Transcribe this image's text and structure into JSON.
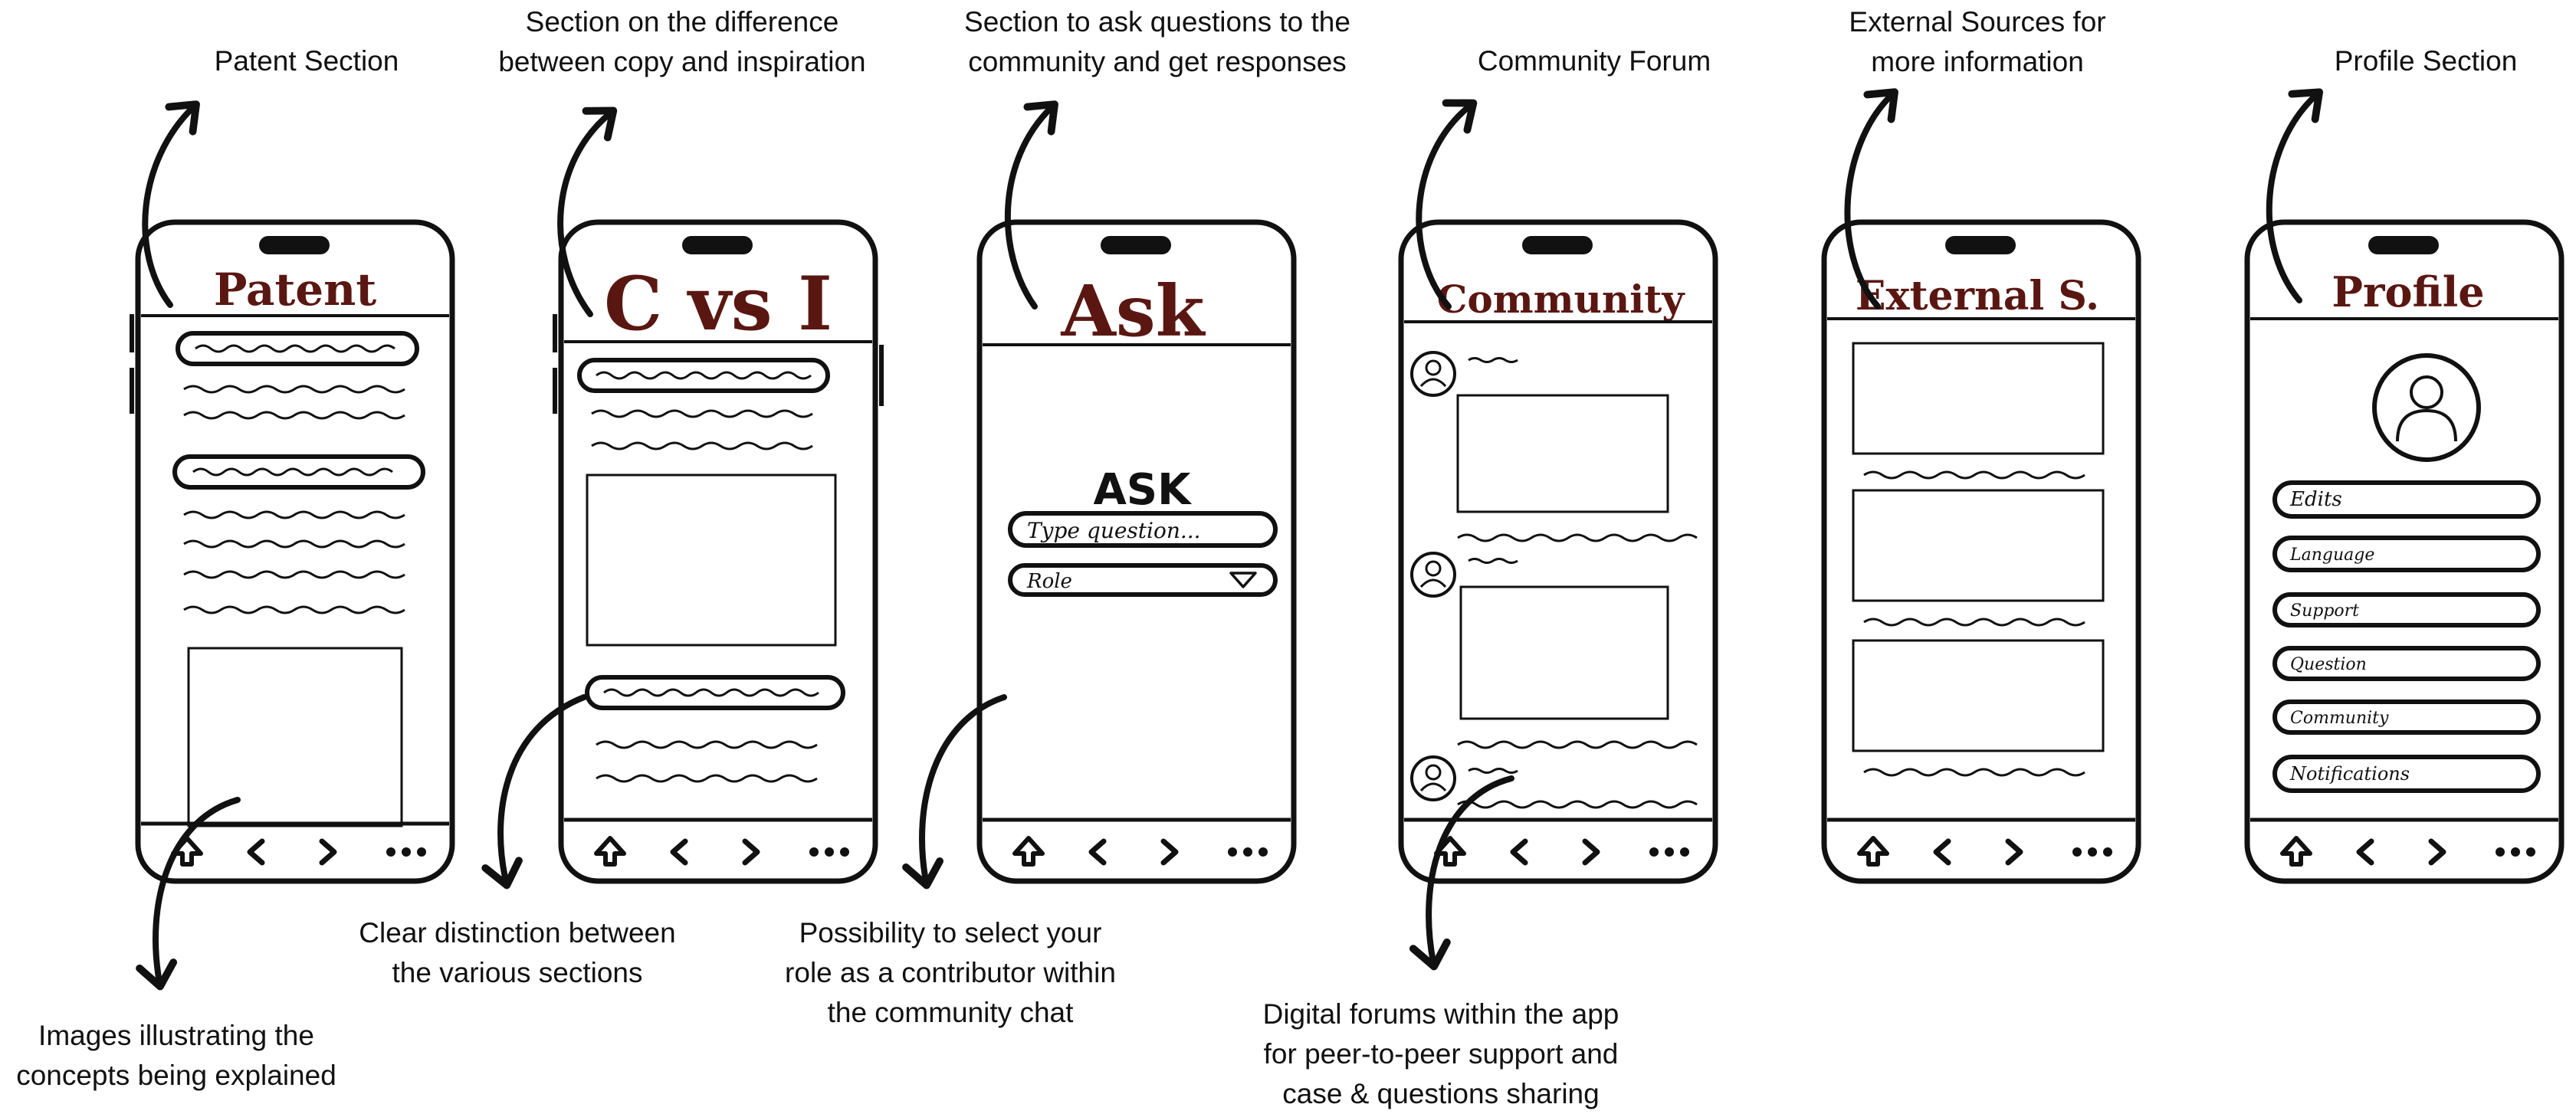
{
  "colors": {
    "ink": "#111111",
    "title_ink": "#5a1712",
    "paper": "#ffffff"
  },
  "top_annotations": [
    {
      "lines": [
        "Patent Section"
      ]
    },
    {
      "lines": [
        "Section on the difference",
        "between copy and inspiration"
      ]
    },
    {
      "lines": [
        "Section to ask questions to the",
        "community and get responses"
      ]
    },
    {
      "lines": [
        "Community Forum"
      ]
    },
    {
      "lines": [
        "External Sources for",
        "more information"
      ]
    },
    {
      "lines": [
        "Profile Section"
      ]
    }
  ],
  "bottom_annotations": [
    {
      "lines": [
        "Images illustrating the",
        "concepts being explained"
      ]
    },
    {
      "lines": [
        "Clear distinction between",
        "the various sections"
      ]
    },
    {
      "lines": [
        "Possibility to select your",
        "role as a contributor within",
        "the community chat"
      ]
    },
    {
      "lines": [
        "Digital forums within the app",
        "for peer-to-peer support and",
        "case & questions sharing"
      ]
    }
  ],
  "phones": [
    {
      "title": "Patent"
    },
    {
      "title": "C vs I"
    },
    {
      "title": "Ask"
    },
    {
      "title": "Community"
    },
    {
      "title": "External S."
    },
    {
      "title": "Profile"
    }
  ],
  "ask_screen": {
    "heading": "ASK",
    "question_placeholder": "Type question...",
    "role_select": "Role"
  },
  "profile_screen": {
    "avatar_icon": "user-avatar-icon",
    "buttons": [
      "Edits",
      "Language",
      "Support",
      "Question",
      "Community",
      "Notifications"
    ]
  },
  "bottom_nav_icons": [
    "home-up-arrow-icon",
    "back-chevron-icon",
    "forward-chevron-icon",
    "more-dots-icon"
  ]
}
